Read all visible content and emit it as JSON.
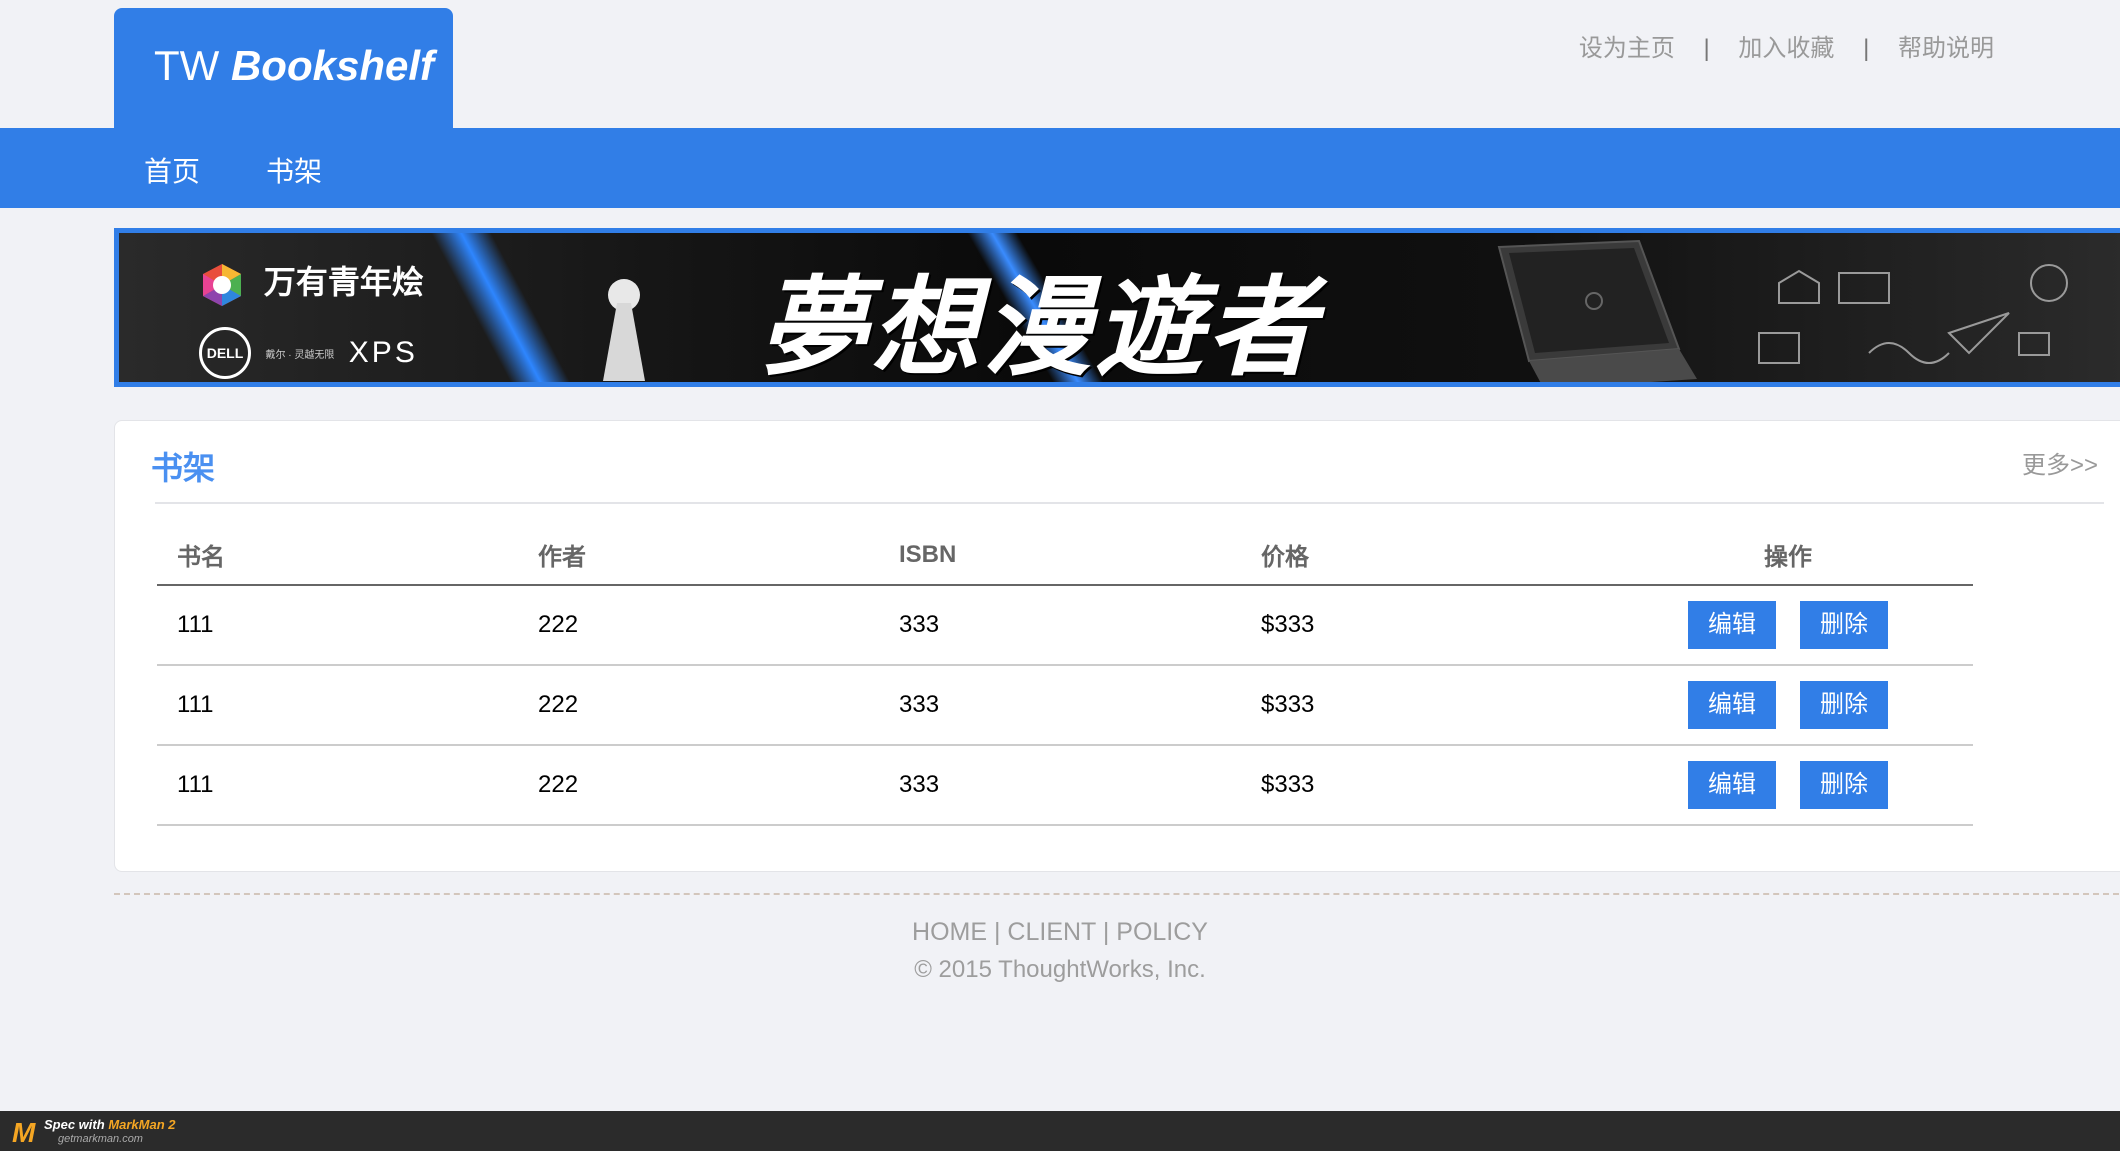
{
  "logo": {
    "prefix": "TW",
    "name": "Bookshelf"
  },
  "top_links": [
    "设为主页",
    "加入收藏",
    "帮助说明"
  ],
  "top_links_sep": "|",
  "nav": [
    "首页",
    "书架"
  ],
  "banner": {
    "brand": "万有青年烩",
    "dell": "DELL",
    "dell_sub": "戴尔 · 灵越无限",
    "xps": "XPS",
    "title": "夢想漫遊者"
  },
  "shelf": {
    "title": "书架",
    "more": "更多>>",
    "columns": [
      "书名",
      "作者",
      "ISBN",
      "价格",
      "操作"
    ],
    "rows": [
      {
        "name": "111",
        "author": "222",
        "isbn": "333",
        "price": "$333"
      },
      {
        "name": "111",
        "author": "222",
        "isbn": "333",
        "price": "$333"
      },
      {
        "name": "111",
        "author": "222",
        "isbn": "333",
        "price": "$333"
      }
    ],
    "edit_label": "编辑",
    "delete_label": "删除"
  },
  "footer": {
    "links": [
      "HOME",
      "CLIENT",
      "POLICY"
    ],
    "sep": "|",
    "copyright": "© 2015 ThoughtWorks, Inc."
  },
  "markman": {
    "spec": "Spec with",
    "name": "MarkMan 2",
    "site": "getmarkman.com"
  },
  "colors": {
    "primary": "#317ee7",
    "title_blue": "#4a90f1",
    "link_gray": "#999999",
    "sep_gray": "#777777",
    "header_gray": "#666666",
    "row_border": "#cccccc",
    "divider": "#e3e4e8",
    "footer_text": "#9d9d9d",
    "footer_line": "#d3c6bc",
    "page_bg": "#f1f2f6"
  }
}
